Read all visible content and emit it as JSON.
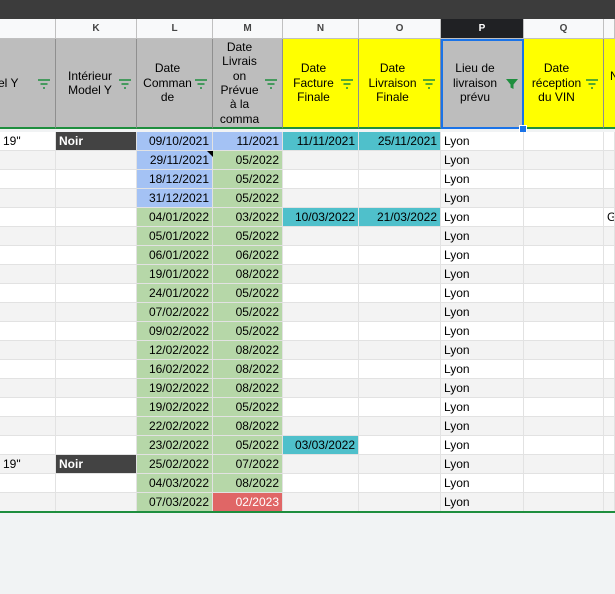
{
  "column_letters": [
    "K",
    "L",
    "M",
    "N",
    "O",
    "P",
    "Q"
  ],
  "headers": {
    "model_y_partial": "el Y",
    "interieur": "Intérieur\nModel Y",
    "date_commande": "Date\nComman\nde",
    "date_livraison_prevue": "Date\nLivrais\non\nPrévue\nà la\ncomma",
    "date_facture": "Date\nFacture\nFinale",
    "date_livraison_finale": "Date\nLivraison\nFinale",
    "lieu_livraison": "Lieu de\nlivraison\nprévu",
    "date_reception_vin": "Date\nréception\ndu VIN",
    "next_partial": "N"
  },
  "rows": [
    {
      "jante": "19\"",
      "interieur": "Noir",
      "commande": "09/10/2021",
      "prevue": "11/2021",
      "facture": "11/11/2021",
      "livraison": "25/11/2021",
      "lieu": "Lyon",
      "extra": ""
    },
    {
      "jante": "",
      "interieur": "",
      "commande": "29/11/2021",
      "prevue": "05/2022",
      "facture": "",
      "livraison": "",
      "lieu": "Lyon",
      "extra": ""
    },
    {
      "jante": "",
      "interieur": "",
      "commande": "18/12/2021",
      "prevue": "05/2022",
      "facture": "",
      "livraison": "",
      "lieu": "Lyon",
      "extra": ""
    },
    {
      "jante": "",
      "interieur": "",
      "commande": "31/12/2021",
      "prevue": "05/2022",
      "facture": "",
      "livraison": "",
      "lieu": "Lyon",
      "extra": ""
    },
    {
      "jante": "",
      "interieur": "",
      "commande": "04/01/2022",
      "prevue": "03/2022",
      "facture": "10/03/2022",
      "livraison": "21/03/2022",
      "lieu": "Lyon",
      "extra": "G"
    },
    {
      "jante": "",
      "interieur": "",
      "commande": "05/01/2022",
      "prevue": "05/2022",
      "facture": "",
      "livraison": "",
      "lieu": "Lyon",
      "extra": ""
    },
    {
      "jante": "",
      "interieur": "",
      "commande": "06/01/2022",
      "prevue": "06/2022",
      "facture": "",
      "livraison": "",
      "lieu": "Lyon",
      "extra": ""
    },
    {
      "jante": "",
      "interieur": "",
      "commande": "19/01/2022",
      "prevue": "08/2022",
      "facture": "",
      "livraison": "",
      "lieu": "Lyon",
      "extra": ""
    },
    {
      "jante": "",
      "interieur": "",
      "commande": "24/01/2022",
      "prevue": "05/2022",
      "facture": "",
      "livraison": "",
      "lieu": "Lyon",
      "extra": ""
    },
    {
      "jante": "",
      "interieur": "",
      "commande": "07/02/2022",
      "prevue": "05/2022",
      "facture": "",
      "livraison": "",
      "lieu": "Lyon",
      "extra": ""
    },
    {
      "jante": "",
      "interieur": "",
      "commande": "09/02/2022",
      "prevue": "05/2022",
      "facture": "",
      "livraison": "",
      "lieu": "Lyon",
      "extra": ""
    },
    {
      "jante": "",
      "interieur": "",
      "commande": "12/02/2022",
      "prevue": "08/2022",
      "facture": "",
      "livraison": "",
      "lieu": "Lyon",
      "extra": ""
    },
    {
      "jante": "",
      "interieur": "",
      "commande": "16/02/2022",
      "prevue": "08/2022",
      "facture": "",
      "livraison": "",
      "lieu": "Lyon",
      "extra": ""
    },
    {
      "jante": "",
      "interieur": "",
      "commande": "19/02/2022",
      "prevue": "08/2022",
      "facture": "",
      "livraison": "",
      "lieu": "Lyon",
      "extra": ""
    },
    {
      "jante": "",
      "interieur": "",
      "commande": "19/02/2022",
      "prevue": "05/2022",
      "facture": "",
      "livraison": "",
      "lieu": "Lyon",
      "extra": ""
    },
    {
      "jante": "",
      "interieur": "",
      "commande": "22/02/2022",
      "prevue": "08/2022",
      "facture": "",
      "livraison": "",
      "lieu": "Lyon",
      "extra": ""
    },
    {
      "jante": "",
      "interieur": "",
      "commande": "23/02/2022",
      "prevue": "05/2022",
      "facture": "03/03/2022",
      "livraison": "",
      "lieu": "Lyon",
      "extra": ""
    },
    {
      "jante": "19\"",
      "interieur": "Noir",
      "commande": "25/02/2022",
      "prevue": "07/2022",
      "facture": "",
      "livraison": "",
      "lieu": "Lyon",
      "extra": ""
    },
    {
      "jante": "",
      "interieur": "",
      "commande": "04/03/2022",
      "prevue": "08/2022",
      "facture": "",
      "livraison": "",
      "lieu": "Lyon",
      "extra": ""
    },
    {
      "jante": "",
      "interieur": "",
      "commande": "07/03/2022",
      "prevue": "02/2023",
      "facture": "",
      "livraison": "",
      "lieu": "Lyon",
      "extra": ""
    }
  ],
  "colors": {
    "header_gray": "#bdbdbd",
    "header_yellow": "#ffff00",
    "commande_blue": "#a4c2f4",
    "commande_green": "#b6d7a8",
    "facture_teal": "#4fc0cb",
    "red": "#e06666",
    "noir_bg": "#434343",
    "filter_green": "#1e8e3e"
  }
}
